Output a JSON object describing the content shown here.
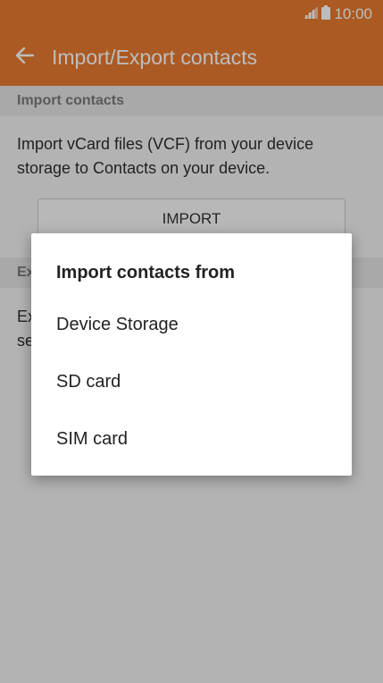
{
  "status_bar": {
    "time": "10:00",
    "signal_icon": "signal-icon",
    "battery_icon": "battery-icon"
  },
  "app_bar": {
    "back_icon": "arrow-left-icon",
    "title": "Import/Export contacts"
  },
  "import_section": {
    "header": "Import contacts",
    "description": "Import vCard files (VCF) from your device storage to Contacts on your device.",
    "button_label": "IMPORT"
  },
  "export_section": {
    "header": "Ex",
    "description_line1": "Ex",
    "description_line2": "se"
  },
  "dialog": {
    "title": "Import contacts from",
    "options": [
      {
        "label": "Device Storage"
      },
      {
        "label": "SD card"
      },
      {
        "label": "SIM card"
      }
    ]
  },
  "colors": {
    "accent": "#e77a30",
    "background": "#f2f2f2",
    "section_header_bg": "#e4e4e4",
    "dialog_bg": "#ffffff"
  }
}
